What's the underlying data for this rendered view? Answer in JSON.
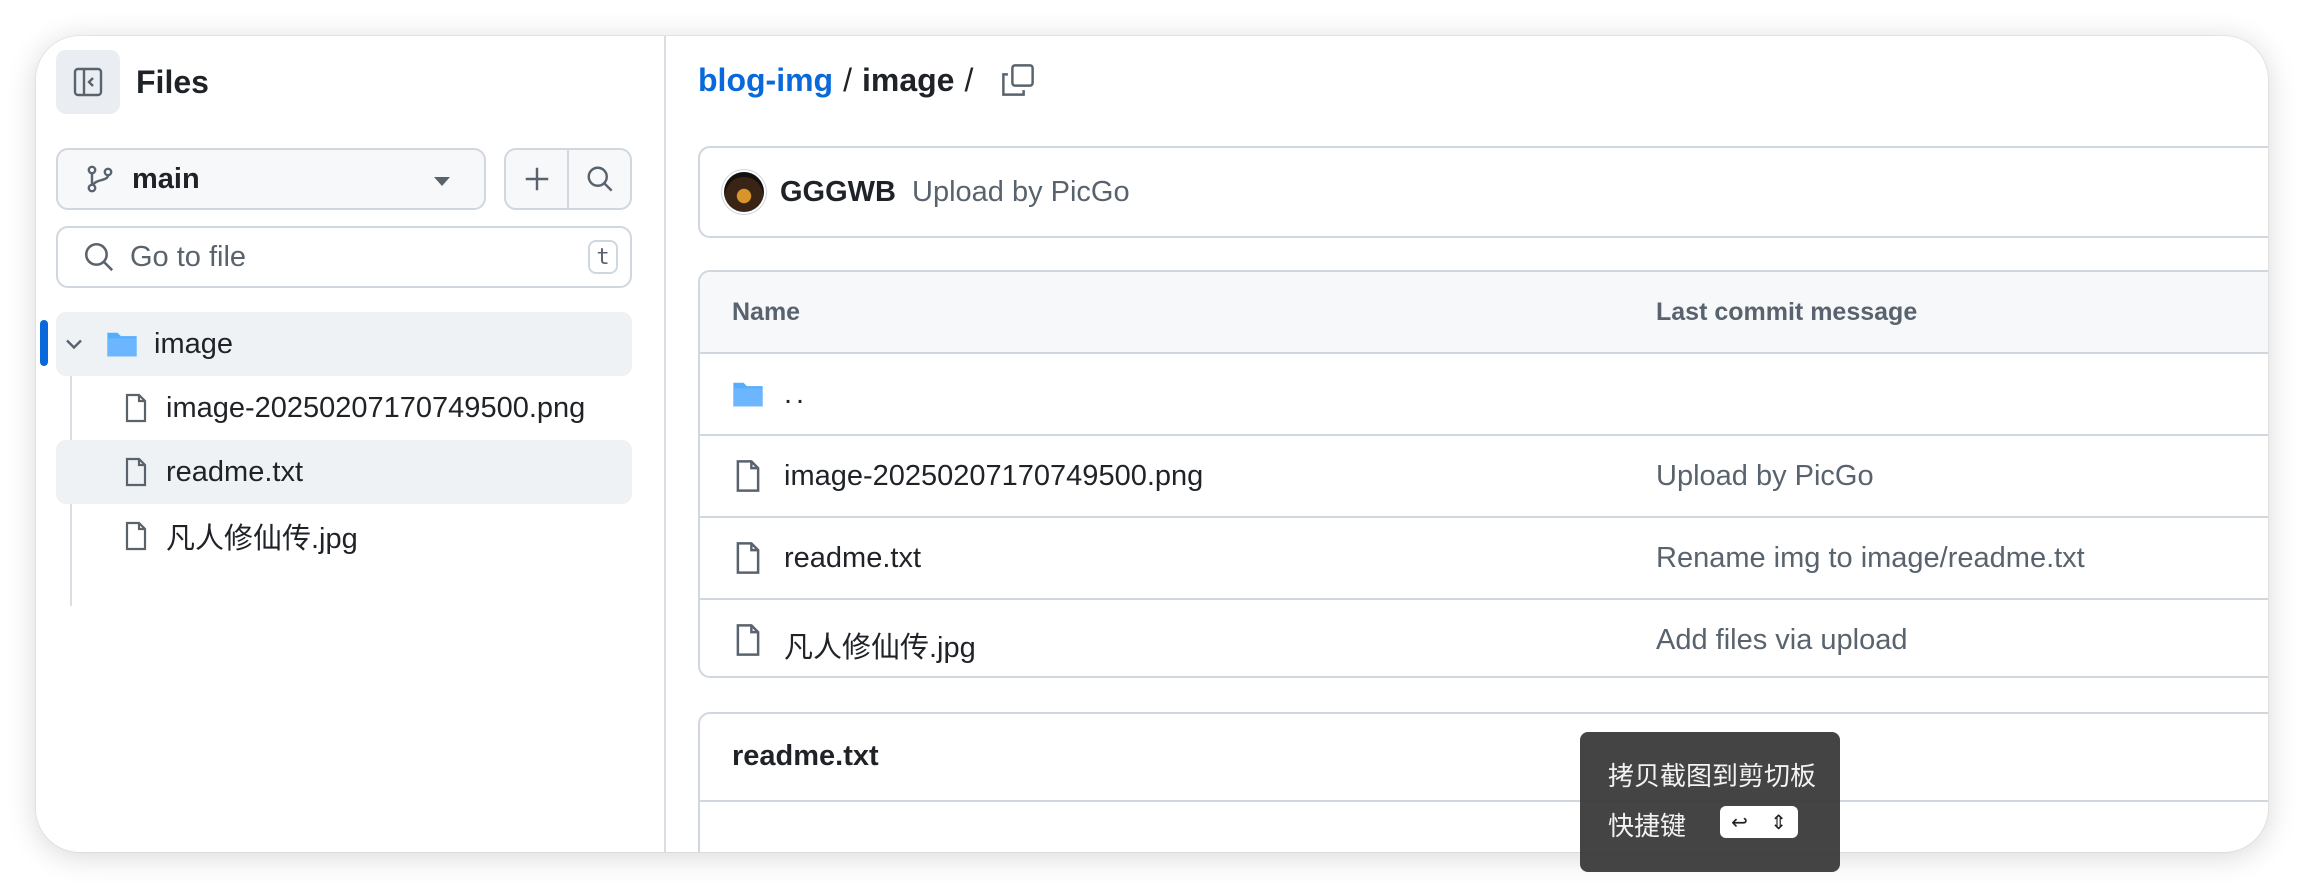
{
  "sidebar": {
    "title": "Files",
    "branch": "main",
    "search_placeholder": "Go to file",
    "search_shortcut": "t",
    "tree": {
      "folder": "image",
      "files": [
        "image-20250207170749500.png",
        "readme.txt",
        "凡人修仙传.jpg"
      ]
    }
  },
  "breadcrumb": {
    "repo": "blog-img",
    "sep1": "/",
    "folder": "image",
    "sep2": "/"
  },
  "commit": {
    "author": "GGGWB",
    "message": "Upload by PicGo"
  },
  "table": {
    "headers": [
      "Name",
      "Last commit message"
    ],
    "parent": "..",
    "rows": [
      {
        "name": "image-20250207170749500.png",
        "message": "Upload by PicGo"
      },
      {
        "name": "readme.txt",
        "message": "Rename img to image/readme.txt"
      },
      {
        "name": "凡人修仙传.jpg",
        "message": "Add files via upload"
      }
    ]
  },
  "readme": {
    "title": "readme.txt"
  },
  "tooltip": {
    "line1": "拷贝截图到剪切板",
    "line2": "快捷键",
    "key_symbol": "↩",
    "key_arrows": "⇕"
  },
  "colors": {
    "link": "#0969da",
    "folder": "#54aeff",
    "muted": "#59636e",
    "border": "#d0d7de"
  }
}
